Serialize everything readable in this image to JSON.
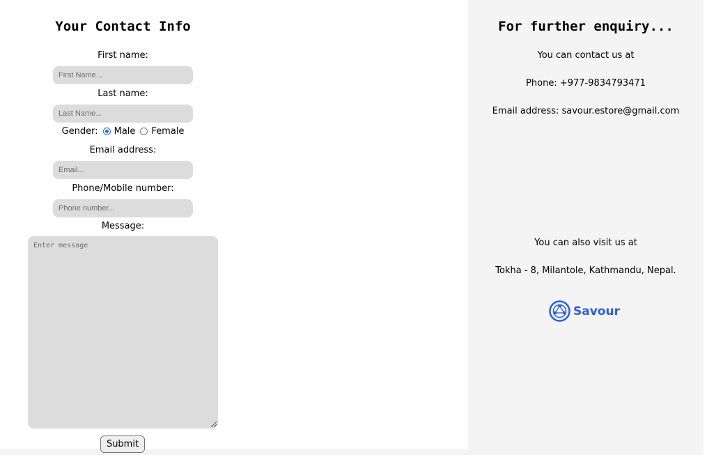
{
  "form": {
    "title": "Your Contact Info",
    "first_name": {
      "label": "First name:",
      "placeholder": "First Name..."
    },
    "last_name": {
      "label": "Last name:",
      "placeholder": "Last Name..."
    },
    "gender": {
      "label": "Gender:",
      "options": [
        "Male",
        "Female"
      ],
      "selected": "Male"
    },
    "email": {
      "label": "Email address:",
      "placeholder": "Email..."
    },
    "phone": {
      "label": "Phone/Mobile number:",
      "placeholder": "Phone number..."
    },
    "message": {
      "label": "Message:",
      "placeholder": "Enter message"
    },
    "submit_label": "Submit"
  },
  "enquiry": {
    "title": "For further enquiry...",
    "contact_intro": "You can contact us at",
    "phone": "Phone: +977-9834793471",
    "email": "Email address: savour.estore@gmail.com",
    "visit_intro": "You can also visit us at",
    "address": "Tokha - 8, Milantole, Kathmandu, Nepal.",
    "logo_text": "Savour",
    "logo_icon": "savour-logo-icon"
  },
  "colors": {
    "accent": "#1a73e8",
    "brand": "#2a5bf0",
    "field_bg": "#dcdcdc",
    "panel_bg": "#f4f4f4"
  }
}
